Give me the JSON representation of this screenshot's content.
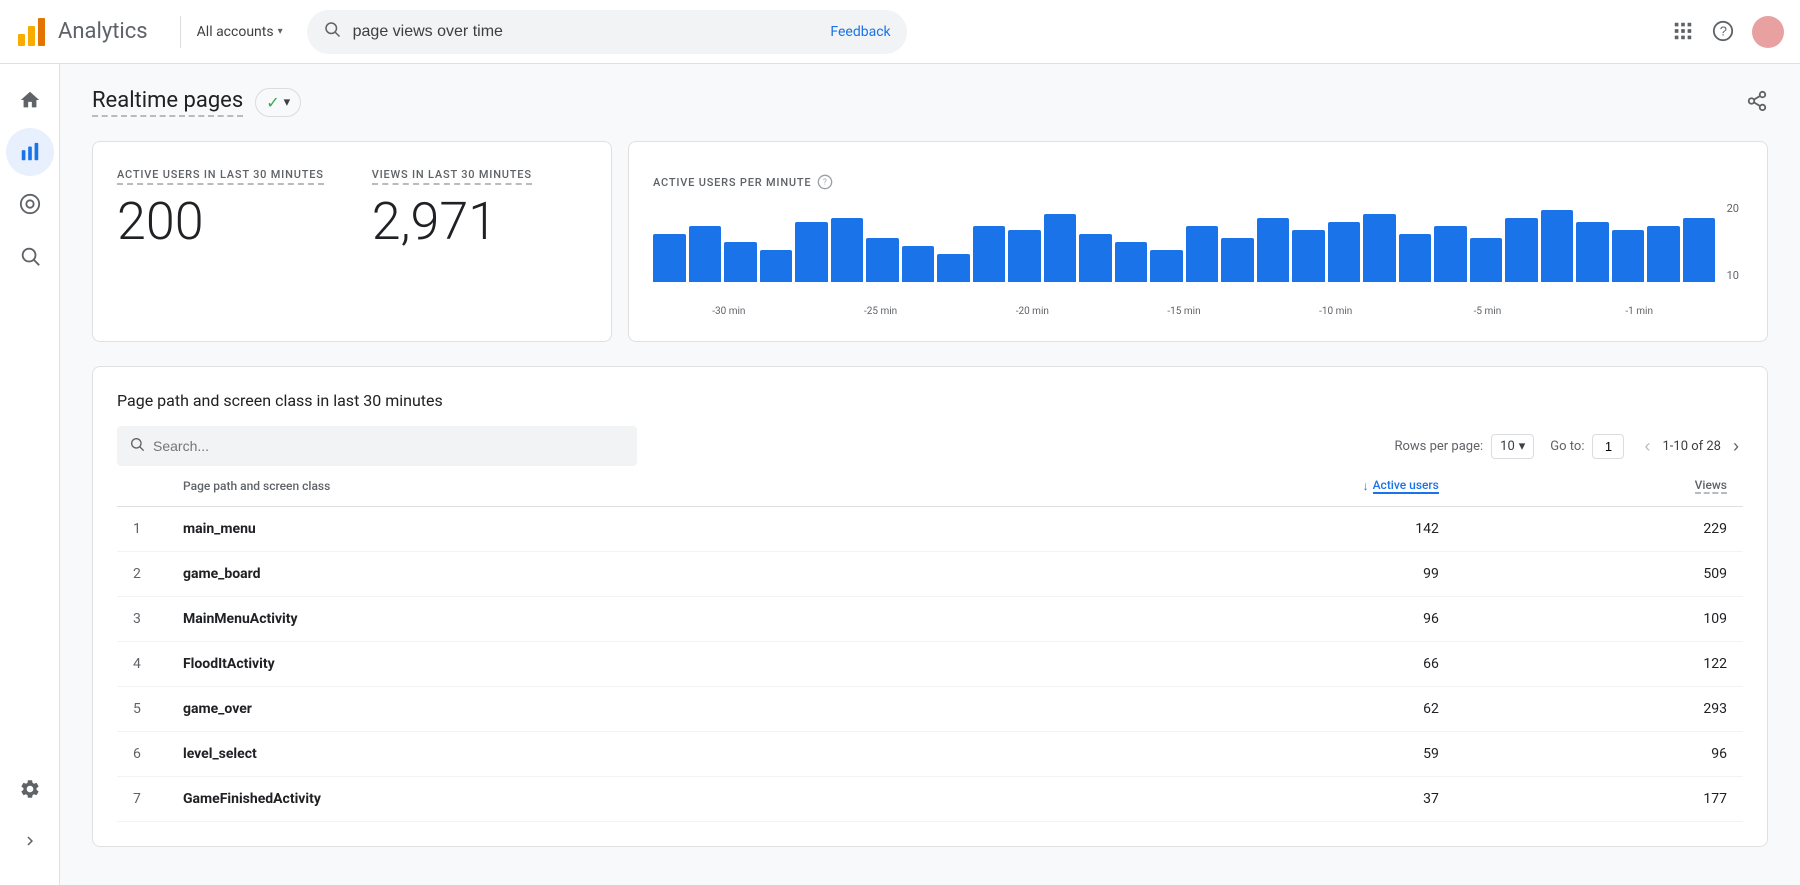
{
  "header": {
    "app_name": "Analytics",
    "all_accounts_label": "All accounts",
    "search_placeholder": "page views over time",
    "search_value": "page views over time",
    "feedback_label": "Feedback",
    "grid_icon": "⊞",
    "help_icon": "?",
    "chevron": "▾"
  },
  "sidebar": {
    "items": [
      {
        "id": "home",
        "icon": "🏠",
        "label": "Home",
        "active": false
      },
      {
        "id": "realtime",
        "icon": "📊",
        "label": "Realtime",
        "active": true
      },
      {
        "id": "audience",
        "icon": "⊙",
        "label": "Audience",
        "active": false
      },
      {
        "id": "search",
        "icon": "⊛",
        "label": "Search",
        "active": false
      }
    ],
    "settings": {
      "icon": "⚙",
      "label": "Settings"
    },
    "collapse_icon": "›"
  },
  "page": {
    "title": "Realtime pages",
    "status": "●",
    "status_label": "▾",
    "share_icon": "share"
  },
  "stats_card": {
    "active_users_label": "ACTIVE USERS IN LAST 30 MINUTES",
    "active_users_value": "200",
    "views_label": "VIEWS IN LAST 30 MINUTES",
    "views_value": "2,971"
  },
  "chart": {
    "title": "ACTIVE USERS PER MINUTE",
    "help_icon": "?",
    "y_max": "20",
    "y_mid": "10",
    "x_labels": [
      "-30 min",
      "-25 min",
      "-20 min",
      "-15 min",
      "-10 min",
      "-5 min",
      "-1 min"
    ],
    "bars": [
      12,
      14,
      10,
      8,
      15,
      16,
      11,
      9,
      7,
      14,
      13,
      17,
      12,
      10,
      8,
      14,
      11,
      16,
      13,
      15,
      17,
      12,
      14,
      11,
      16,
      18,
      15,
      13,
      14,
      16
    ]
  },
  "table_section": {
    "title": "Page path and screen class in last 30 minutes",
    "search_placeholder": "Search...",
    "rows_per_page_label": "Rows per page:",
    "rows_per_page_value": "10",
    "go_to_label": "Go to:",
    "page_value": "1",
    "page_range": "1-10 of 28",
    "col_page_path": "Page path and screen class",
    "col_active_users": "Active users",
    "col_views": "Views",
    "rows": [
      {
        "num": 1,
        "path": "main_menu",
        "active_users": "142",
        "views": "229"
      },
      {
        "num": 2,
        "path": "game_board",
        "active_users": "99",
        "views": "509"
      },
      {
        "num": 3,
        "path": "MainMenuActivity",
        "active_users": "96",
        "views": "109"
      },
      {
        "num": 4,
        "path": "FloodItActivity",
        "active_users": "66",
        "views": "122"
      },
      {
        "num": 5,
        "path": "game_over",
        "active_users": "62",
        "views": "293"
      },
      {
        "num": 6,
        "path": "level_select",
        "active_users": "59",
        "views": "96"
      },
      {
        "num": 7,
        "path": "GameFinishedActivity",
        "active_users": "37",
        "views": "177"
      }
    ]
  }
}
